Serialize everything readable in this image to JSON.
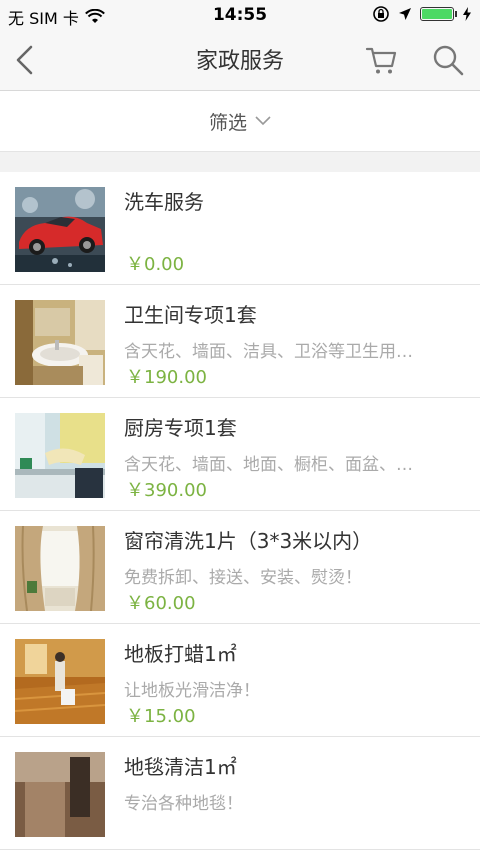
{
  "status_bar": {
    "carrier": "无 SIM 卡",
    "time": "14:55",
    "battery_level": 1.0
  },
  "nav": {
    "title": "家政服务",
    "icons": [
      "back-chevron-icon",
      "cart-icon",
      "search-icon"
    ]
  },
  "filter": {
    "label": "筛选"
  },
  "colors": {
    "price": "#7cb342",
    "accent_car": "#d62a2a"
  },
  "items": [
    {
      "title": "洗车服务",
      "desc": "",
      "price": "￥0.00",
      "image": "red-sports-car"
    },
    {
      "title": "卫生间专项1套",
      "desc": "含天花、墙面、洁具、卫浴等卫生用…",
      "price": "￥190.00",
      "image": "bathroom-sink"
    },
    {
      "title": "厨房专项1套",
      "desc": "含天花、墙面、地面、橱柜、面盆、…",
      "price": "￥390.00",
      "image": "kitchen-cleaning"
    },
    {
      "title": "窗帘清洗1片（3*3米以内）",
      "desc": "免费拆卸、接送、安装、熨烫！",
      "price": "￥60.00",
      "image": "curtain-room"
    },
    {
      "title": "地板打蜡1㎡",
      "desc": "让地板光滑洁净！",
      "price": "￥15.00",
      "image": "floor-waxing"
    },
    {
      "title": "地毯清洁1㎡",
      "desc": "专治各种地毯！",
      "price": "",
      "image": "carpet-cleaning"
    }
  ]
}
